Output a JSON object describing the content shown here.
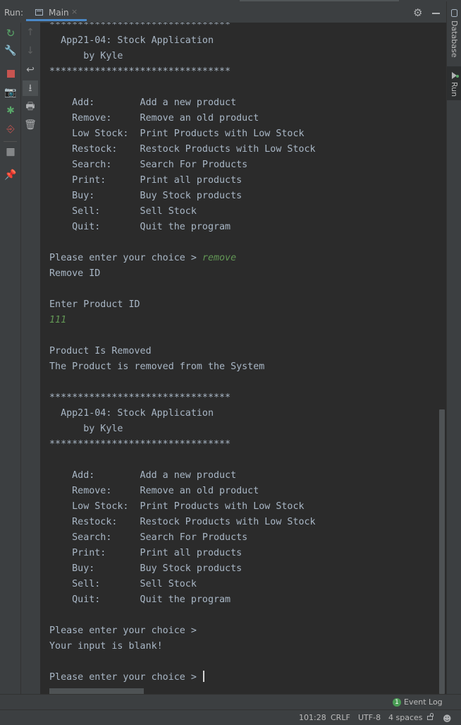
{
  "header": {
    "run_label": "Run:",
    "tab_label": "Main",
    "tab_close": "×"
  },
  "tool_window": {
    "database_label": "Database",
    "run_label": "Run"
  },
  "toolbar_icons": [
    "rerun-icon",
    "wrench-icon",
    "stop-icon",
    "camera-icon",
    "bug-icon",
    "exit-icon",
    "layout-icon",
    "pin-icon"
  ],
  "console_icons": [
    "up-arrow-icon",
    "down-arrow-icon",
    "soft-wrap-icon",
    "scroll-to-end-icon",
    "print-icon",
    "trash-icon"
  ],
  "colors": {
    "console_text": "#a9b7c6",
    "user_input": "#629755",
    "background": "#2b2b2b",
    "panel": "#3c3f41",
    "accent": "#4a88c7"
  },
  "console": {
    "lines": [
      "********************************",
      "  App21-04: Stock Application",
      "      by Kyle",
      "********************************",
      "",
      "    Add:        Add a new product",
      "    Remove:     Remove an old product",
      "    Low Stock:  Print Products with Low Stock",
      "    Restock:    Restock Products with Low Stock",
      "    Search:     Search For Products",
      "    Print:      Print all products",
      "    Buy:        Buy Stock products",
      "    Sell:       Sell Stock",
      "    Quit:       Quit the program",
      "",
      "Please enter your choice > ",
      "Remove ID",
      "",
      "Enter Product ID",
      "",
      "",
      "Product Is Removed",
      "The Product is removed from the System",
      "",
      "********************************",
      "  App21-04: Stock Application",
      "      by Kyle",
      "********************************",
      "",
      "    Add:        Add a new product",
      "    Remove:     Remove an old product",
      "    Low Stock:  Print Products with Low Stock",
      "    Restock:    Restock Products with Low Stock",
      "    Search:     Search For Products",
      "    Print:      Print all products",
      "    Buy:        Buy Stock products",
      "    Sell:       Sell Stock",
      "    Quit:       Quit the program",
      "",
      "Please enter your choice >",
      "Your input is blank!",
      "",
      "Please enter your choice > "
    ],
    "user_input_remove": "remove",
    "user_input_id": "111"
  },
  "event_log": {
    "badge": "1",
    "label": "Event Log"
  },
  "status": {
    "position": "101:28",
    "line_sep": "CRLF",
    "encoding": "UTF-8",
    "indent": "4 spaces"
  }
}
